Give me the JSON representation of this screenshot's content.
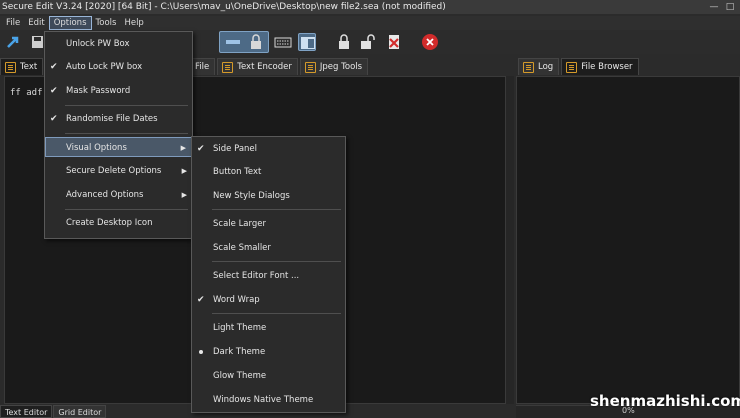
{
  "window": {
    "title": "Secure Edit V3.24 [2020] [64 Bit] - C:\\Users\\mav_u\\OneDrive\\Desktop\\new file2.sea (not modified)",
    "minimize_glyph": "—",
    "maximize_glyph": "□"
  },
  "menubar": {
    "items": [
      "File",
      "Edit",
      "Options",
      "Tools",
      "Help"
    ],
    "active_index": 2
  },
  "left_tabs": [
    {
      "label": "Text"
    },
    {
      "label": "File"
    },
    {
      "label": "Text Encoder"
    },
    {
      "label": "Jpeg Tools"
    }
  ],
  "right_tabs": [
    {
      "label": "Log"
    },
    {
      "label": "File Browser"
    }
  ],
  "editor": {
    "visible_text": "ff adf"
  },
  "options_menu": {
    "items": [
      {
        "label": "Unlock PW Box",
        "checked": false
      },
      {
        "label": "Auto Lock PW box",
        "checked": true
      },
      {
        "label": "Mask Password",
        "checked": true
      },
      {
        "label": "Randomise File Dates",
        "checked": true
      },
      {
        "label": "Visual Options",
        "submenu": true,
        "highlighted": true
      },
      {
        "label": "Secure Delete Options",
        "submenu": true
      },
      {
        "label": "Advanced Options",
        "submenu": true
      },
      {
        "label": "Create Desktop Icon"
      }
    ]
  },
  "visual_options_menu": {
    "items": [
      {
        "label": "Side Panel",
        "checked": true
      },
      {
        "label": "Button Text"
      },
      {
        "label": "New Style Dialogs"
      },
      {
        "label": "Scale Larger"
      },
      {
        "label": "Scale Smaller"
      },
      {
        "label": "Select Editor Font ..."
      },
      {
        "label": "Word Wrap",
        "checked": true
      },
      {
        "label": "Light Theme"
      },
      {
        "label": "Dark Theme",
        "selected": true
      },
      {
        "label": "Glow Theme"
      },
      {
        "label": "Windows Native Theme"
      }
    ]
  },
  "bottom_tabs": [
    "Text Editor",
    "Grid Editor"
  ],
  "status": {
    "progress_percent": 0,
    "progress_text": "0%"
  },
  "watermark": "shenmazhishi.com",
  "glyphs": {
    "check": "✔",
    "submenu_arrow": "▶",
    "close": "✕"
  },
  "colors": {
    "accent_highlight": "#4a5868",
    "tab_icon_orange": "#d49a2a",
    "toolbar_selected": "#4d6a86",
    "red_button": "#d12b2b"
  }
}
